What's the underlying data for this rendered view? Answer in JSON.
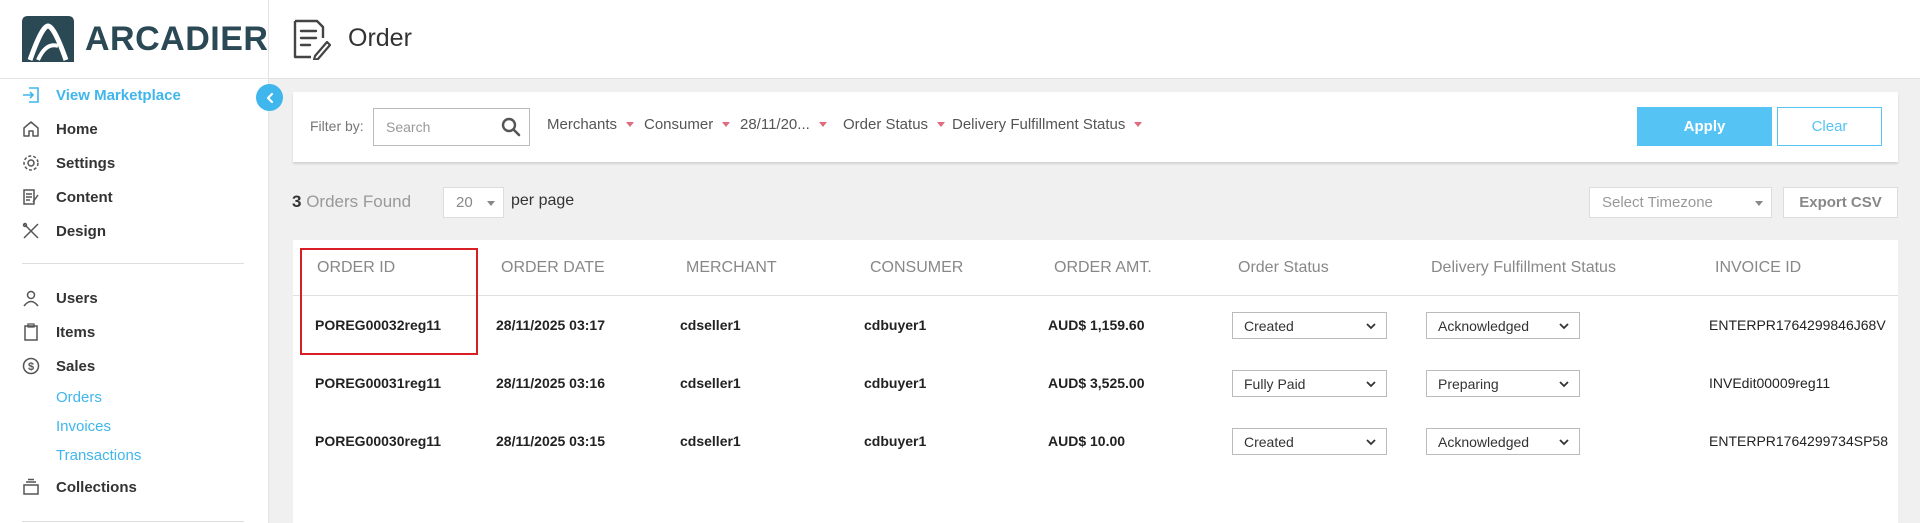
{
  "header": {
    "brand": "ARCADIER",
    "page_title": "Order"
  },
  "sidebar": {
    "items": [
      {
        "label": "View Marketplace",
        "icon": "sign-in-icon",
        "active": true
      },
      {
        "label": "Home",
        "icon": "home-icon"
      },
      {
        "label": "Settings",
        "icon": "gear-icon"
      },
      {
        "label": "Content",
        "icon": "content-icon"
      },
      {
        "label": "Design",
        "icon": "design-tools-icon"
      },
      {
        "label": "Users",
        "icon": "user-icon"
      },
      {
        "label": "Items",
        "icon": "clipboard-icon"
      },
      {
        "label": "Sales",
        "icon": "dollar-icon"
      },
      {
        "label": "Collections",
        "icon": "collections-icon"
      }
    ],
    "sales_sub": [
      "Orders",
      "Invoices",
      "Transactions"
    ]
  },
  "filter": {
    "label": "Filter by:",
    "search_placeholder": "Search",
    "dropdowns": [
      "Merchants",
      "Consumer",
      "28/11/20...",
      "Order Status",
      "Delivery Fulfillment Status"
    ],
    "apply": "Apply",
    "clear": "Clear"
  },
  "summary": {
    "count": "3",
    "found_label": "Orders Found",
    "per_page_value": "20",
    "per_page_label": "per page",
    "timezone_placeholder": "Select Timezone",
    "export": "Export CSV"
  },
  "table": {
    "headers": [
      "ORDER ID",
      "ORDER DATE",
      "MERCHANT",
      "CONSUMER",
      "ORDER AMT.",
      "Order Status",
      "Delivery Fulfillment Status",
      "INVOICE ID"
    ],
    "rows": [
      {
        "order_id": "POREG00032reg11",
        "date": "28/11/2025 03:17",
        "merchant": "cdseller1",
        "consumer": "cdbuyer1",
        "amount": "AUD$ 1,159.60",
        "status": "Created",
        "fulfillment": "Acknowledged",
        "invoice": "ENTERPR1764299846J68V"
      },
      {
        "order_id": "POREG00031reg11",
        "date": "28/11/2025 03:16",
        "merchant": "cdseller1",
        "consumer": "cdbuyer1",
        "amount": "AUD$ 3,525.00",
        "status": "Fully Paid",
        "fulfillment": "Preparing",
        "invoice": "INVEdit00009reg11"
      },
      {
        "order_id": "POREG00030reg11",
        "date": "28/11/2025 03:15",
        "merchant": "cdseller1",
        "consumer": "cdbuyer1",
        "amount": "AUD$ 10.00",
        "status": "Created",
        "fulfillment": "Acknowledged",
        "invoice": "ENTERPR1764299734SP58"
      }
    ]
  },
  "colors": {
    "accent": "#3fb6ec",
    "brand": "#2b4855",
    "highlight": "#d81f26",
    "caret": "#e06b7d"
  }
}
